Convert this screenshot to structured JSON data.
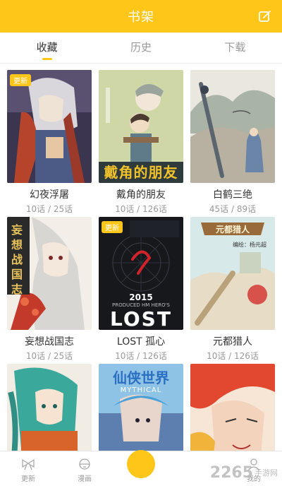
{
  "header": {
    "title": "书架",
    "edit_icon": "edit-icon"
  },
  "tabs": [
    {
      "label": "收藏",
      "active": true
    },
    {
      "label": "历史",
      "active": false
    },
    {
      "label": "下载",
      "active": false
    }
  ],
  "books": [
    {
      "title": "幻夜浮屠",
      "progress": "10话 / 25话",
      "badge": "更新"
    },
    {
      "title": "戴角的朋友",
      "progress": "10话 / 126话",
      "badge": ""
    },
    {
      "title": "白鹤三绝",
      "progress": "45话 / 89话",
      "badge": ""
    },
    {
      "title": "妄想战国志",
      "progress": "10话 / 25话",
      "badge": ""
    },
    {
      "title": "LOST 孤心",
      "progress": "10话 / 126话",
      "badge": "更新"
    },
    {
      "title": "元都猎人",
      "progress": "10话 / 126话",
      "badge": ""
    },
    {
      "title": "",
      "progress": "",
      "badge": ""
    },
    {
      "title": "",
      "progress": "",
      "badge": ""
    },
    {
      "title": "",
      "progress": "",
      "badge": ""
    }
  ],
  "covers": {
    "c2_title": "戴角的朋友",
    "c4_title": "妄想战国志",
    "c5_year": "2015",
    "c5_sub": "PRODUCED HM HERO'S",
    "c5_big": "LOST",
    "c6_title": "元都猎人",
    "c6_author": "编绘：杨元超",
    "c8_title": "仙侠世界",
    "c8_en": "MYTHICAL"
  },
  "nav": [
    {
      "label": "更新",
      "icon": "bow-icon",
      "active": false
    },
    {
      "label": "漫画",
      "icon": "bell-icon",
      "active": false
    },
    {
      "label": "",
      "icon": "bookshelf-icon",
      "active": true
    },
    {
      "label": "",
      "icon": "",
      "active": false
    },
    {
      "label": "我的",
      "icon": "user-icon",
      "active": false
    }
  ],
  "watermark": {
    "number": "2265",
    "text": "手游网"
  },
  "colors": {
    "accent": "#ffc61a",
    "text": "#333333",
    "muted": "#999999"
  }
}
